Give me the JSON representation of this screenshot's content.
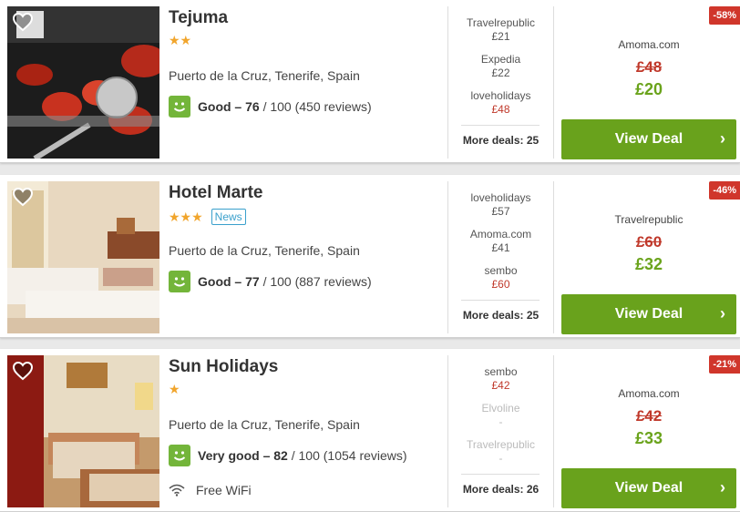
{
  "hotels": [
    {
      "name": "Tejuma",
      "stars": "★★",
      "news_badge": "",
      "location": "Puerto de la Cruz, Tenerife, Spain",
      "rating_label": "Good – 76",
      "rating_rest": " / 100 (450 reviews)",
      "amenity": "",
      "other_deals": [
        {
          "site": "Travelrepublic",
          "price": "£21",
          "style": "normal"
        },
        {
          "site": "Expedia",
          "price": "£22",
          "style": "normal"
        },
        {
          "site": "loveholidays",
          "price": "£48",
          "style": "red"
        }
      ],
      "more_deals": "More deals: 25",
      "discount": "-58%",
      "deal_site": "Amoma.com",
      "old_price": "£48",
      "new_price": "£20",
      "button": "View Deal"
    },
    {
      "name": "Hotel Marte",
      "stars": "★★★",
      "news_badge": "News",
      "location": "Puerto de la Cruz, Tenerife, Spain",
      "rating_label": "Good – 77",
      "rating_rest": " / 100 (887 reviews)",
      "amenity": "",
      "other_deals": [
        {
          "site": "loveholidays",
          "price": "£57",
          "style": "normal"
        },
        {
          "site": "Amoma.com",
          "price": "£41",
          "style": "normal"
        },
        {
          "site": "sembo",
          "price": "£60",
          "style": "red"
        }
      ],
      "more_deals": "More deals: 25",
      "discount": "-46%",
      "deal_site": "Travelrepublic",
      "old_price": "£60",
      "new_price": "£32",
      "button": "View Deal"
    },
    {
      "name": "Sun Holidays",
      "stars": "★",
      "news_badge": "",
      "location": "Puerto de la Cruz, Tenerife, Spain",
      "rating_label": "Very good – 82",
      "rating_rest": " / 100 (1054 reviews)",
      "amenity": "Free WiFi",
      "other_deals": [
        {
          "site": "sembo",
          "price": "£42",
          "style": "red"
        },
        {
          "site": "Elvoline",
          "price": "-",
          "style": "dim"
        },
        {
          "site": "Travelrepublic",
          "price": "-",
          "style": "dim"
        }
      ],
      "more_deals": "More deals: 26",
      "discount": "-21%",
      "deal_site": "Amoma.com",
      "old_price": "£42",
      "new_price": "£33",
      "button": "View Deal"
    }
  ],
  "colors": {
    "accent_green": "#69a21c",
    "price_red": "#c0392b",
    "discount_bg": "#d0362b",
    "star": "#f1a52c",
    "rating_green": "#73b53a"
  },
  "icons": [
    "heart-icon",
    "smiley-icon",
    "wifi-icon",
    "chevron-right-icon"
  ]
}
